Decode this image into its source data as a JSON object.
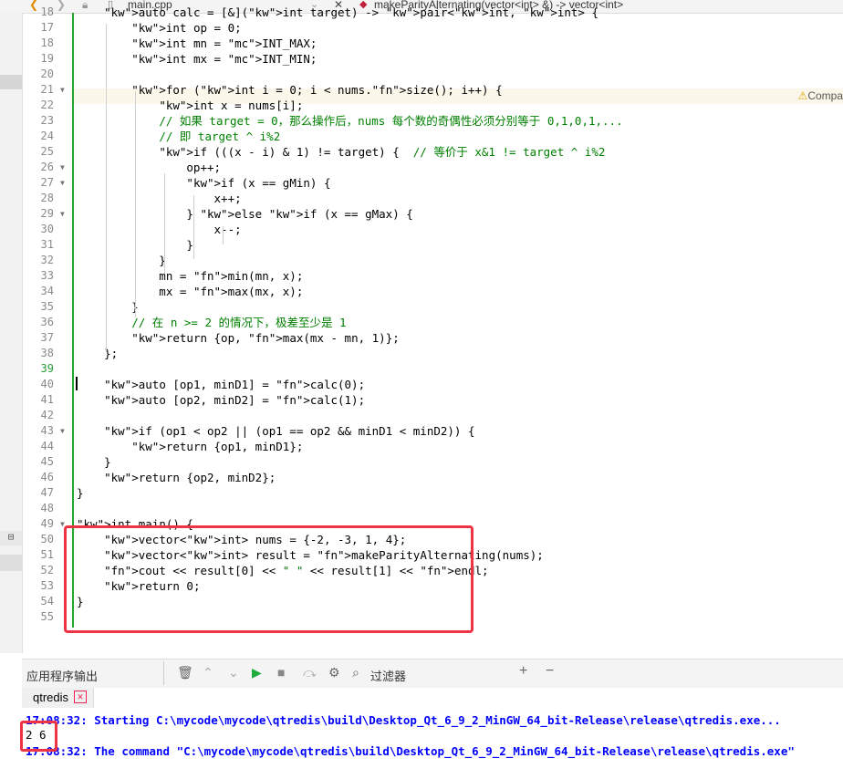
{
  "toolbar": {
    "back_glyph": "❮",
    "forward_glyph": "❯",
    "file_name": "main.cpp",
    "close_glyph": "✕",
    "function_signature": "makeParityAlternating(vector<int> &) -> vector<int>"
  },
  "editor": {
    "warning_text": "Compa",
    "line_numbers": [
      "18",
      "17",
      "18",
      "19",
      "20",
      "21",
      "22",
      "23",
      "24",
      "25",
      "26",
      "27",
      "28",
      "29",
      "30",
      "31",
      "32",
      "33",
      "34",
      "35",
      "36",
      "37",
      "38",
      "39",
      "40",
      "41",
      "42",
      "43",
      "44",
      "45",
      "46",
      "47",
      "48",
      "49",
      "50",
      "51",
      "52",
      "53",
      "54",
      "55"
    ],
    "lines": [
      "    auto calc = [&](int target) -> pair<int, int> {",
      "        int op = 0;",
      "        int mn = INT_MAX;",
      "        int mx = INT_MIN;",
      "",
      "        for (int i = 0; i < nums.size(); i++) {",
      "            int x = nums[i];",
      "            // 如果 target = 0，那么操作后，nums 每个数的奇偶性必须分别等于 0,1,0,1,...",
      "            // 即 target ^ i%2",
      "            if (((x - i) & 1) != target) {  // 等价于 x&1 != target ^ i%2",
      "                op++;",
      "                if (x == gMin) {",
      "                    x++;",
      "                } else if (x == gMax) {",
      "                    x--;",
      "                }",
      "            }",
      "            mn = min(mn, x);",
      "            mx = max(mx, x);",
      "        }",
      "        // 在 n >= 2 的情况下，极差至少是 1",
      "        return {op, max(mx - mn, 1)};",
      "    };",
      "",
      "    auto [op1, minD1] = calc(0);",
      "    auto [op2, minD2] = calc(1);",
      "",
      "    if (op1 < op2 || (op1 == op2 && minD1 < minD2)) {",
      "        return {op1, minD1};",
      "    }",
      "    return {op2, minD2};",
      "}",
      "",
      "int main() {",
      "    vector<int> nums = {-2, -3, 1, 4};",
      "    vector<int> result = makeParityAlternating(nums);",
      "    cout << result[0] << \" \" << result[1] << endl;",
      "    return 0;",
      "}",
      ""
    ]
  },
  "output": {
    "panel_title": "应用程序输出",
    "filter_placeholder": "过滤器",
    "tab_label": "qtredis",
    "tab_close": "✕",
    "add_glyph": "+",
    "minus_glyph": "−",
    "lines": [
      "17:08:32: Starting C:\\mycode\\mycode\\qtredis\\build\\Desktop_Qt_6_9_2_MinGW_64_bit-Release\\release\\qtredis.exe...",
      "2 6",
      "17:08:32: The command \"C:\\mycode\\mycode\\qtredis\\build\\Desktop_Qt_6_9_2_MinGW_64_bit-Release\\release\\qtredis.exe\""
    ]
  },
  "colors": {
    "keyword": "#808000",
    "function": "#00677c",
    "comment": "#008000",
    "output_blue": "#0000ff",
    "highlight_red": "#ee3344",
    "change_bar": "#25a52c"
  }
}
